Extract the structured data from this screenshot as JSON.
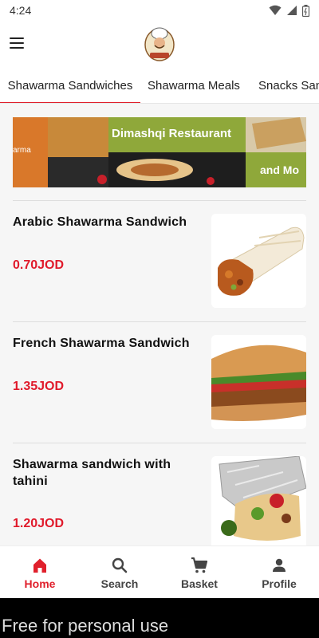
{
  "status_bar": {
    "time": "4:24"
  },
  "app_bar": {
    "menu_icon": "menu-icon",
    "logo": "chef-logo"
  },
  "tabs": [
    {
      "label": "Shawarma Sandwiches",
      "active": true
    },
    {
      "label": "Shawarma Meals",
      "active": false
    },
    {
      "label": "Snacks San",
      "active": false
    }
  ],
  "banner": {
    "left_text": "arma",
    "title": "Dimashqi Restaurant",
    "tag": "and Mo"
  },
  "products": [
    {
      "name": "Arabic Shawarma Sandwich",
      "price": "0.70JOD",
      "image": "shawarma-wrap-photo"
    },
    {
      "name": "French Shawarma Sandwich",
      "price": "1.35JOD",
      "image": "baguette-sandwich-photo"
    },
    {
      "name": "Shawarma sandwich with tahini",
      "price": "1.20JOD",
      "image": "wrap-in-foil-photo"
    }
  ],
  "bottom_nav": [
    {
      "label": "Home",
      "icon": "home-icon",
      "active": true
    },
    {
      "label": "Search",
      "icon": "search-icon",
      "active": false
    },
    {
      "label": "Basket",
      "icon": "cart-icon",
      "active": false
    },
    {
      "label": "Profile",
      "icon": "person-icon",
      "active": false
    }
  ],
  "watermark": "Free for personal use",
  "colors": {
    "accent": "#e0202c",
    "price": "#e01a2b",
    "banner_green": "#8fa83a"
  }
}
